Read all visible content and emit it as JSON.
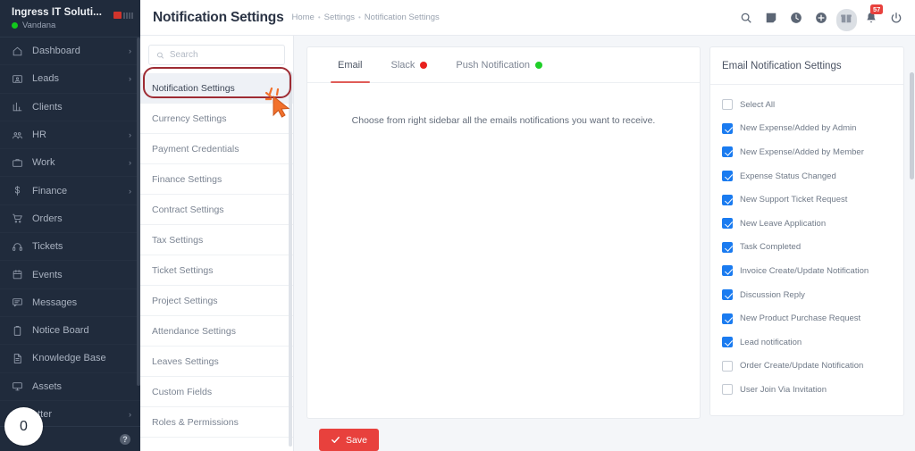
{
  "sidebar": {
    "company": "Ingress IT Soluti...",
    "user": "Vandana",
    "status_color": "#12c81c",
    "items": [
      {
        "label": "Dashboard",
        "icon": "home-icon",
        "chevron": "›"
      },
      {
        "label": "Leads",
        "icon": "leads-card-icon",
        "chevron": "›"
      },
      {
        "label": "Clients",
        "icon": "bar-chart-icon",
        "chevron": ""
      },
      {
        "label": "HR",
        "icon": "people-icon",
        "chevron": "›"
      },
      {
        "label": "Work",
        "icon": "briefcase-icon",
        "chevron": "›"
      },
      {
        "label": "Finance",
        "icon": "dollar-icon",
        "chevron": "›"
      },
      {
        "label": "Orders",
        "icon": "cart-icon",
        "chevron": ""
      },
      {
        "label": "Tickets",
        "icon": "headset-icon",
        "chevron": ""
      },
      {
        "label": "Events",
        "icon": "calendar-icon",
        "chevron": ""
      },
      {
        "label": "Messages",
        "icon": "chat-icon",
        "chevron": ""
      },
      {
        "label": "Notice Board",
        "icon": "clipboard-icon",
        "chevron": ""
      },
      {
        "label": "Knowledge Base",
        "icon": "document-icon",
        "chevron": ""
      },
      {
        "label": "Assets",
        "icon": "monitor-icon",
        "chevron": ""
      },
      {
        "label": "etter",
        "icon": "newsletter-icon",
        "chevron": "›"
      }
    ],
    "bubble_count": "0",
    "help_glyph": "?"
  },
  "header": {
    "title": "Notification Settings",
    "breadcrumbs": [
      "Home",
      "Settings",
      "Notification Settings"
    ],
    "separator": "•",
    "icons": [
      {
        "name": "search-icon"
      },
      {
        "name": "note-icon"
      },
      {
        "name": "clock-icon"
      },
      {
        "name": "plus-circle-icon"
      },
      {
        "name": "gift-icon"
      },
      {
        "name": "bell-icon",
        "badge": "57"
      },
      {
        "name": "power-icon"
      }
    ]
  },
  "settings_list": {
    "search_placeholder": "Search",
    "search_value": "",
    "items": [
      {
        "label": "Notification Settings",
        "active": true
      },
      {
        "label": "Currency Settings",
        "active": false
      },
      {
        "label": "Payment Credentials",
        "active": false
      },
      {
        "label": "Finance Settings",
        "active": false
      },
      {
        "label": "Contract Settings",
        "active": false
      },
      {
        "label": "Tax Settings",
        "active": false
      },
      {
        "label": "Ticket Settings",
        "active": false
      },
      {
        "label": "Project Settings",
        "active": false
      },
      {
        "label": "Attendance Settings",
        "active": false
      },
      {
        "label": "Leaves Settings",
        "active": false
      },
      {
        "label": "Custom Fields",
        "active": false
      },
      {
        "label": "Roles & Permissions",
        "active": false
      }
    ],
    "highlight_color": "#9e2b33"
  },
  "tabs": [
    {
      "label": "Email",
      "active": true,
      "dot": ""
    },
    {
      "label": "Slack",
      "active": false,
      "dot": "#e8201e"
    },
    {
      "label": "Push Notification",
      "active": false,
      "dot": "#1fcf28"
    }
  ],
  "panel": {
    "message": "Choose from right sidebar all the emails notifications you want to receive."
  },
  "email_settings": {
    "title": "Email Notification Settings",
    "options": [
      {
        "label": "Select All",
        "checked": false
      },
      {
        "label": "New Expense/Added by Admin",
        "checked": true
      },
      {
        "label": "New Expense/Added by Member",
        "checked": true
      },
      {
        "label": "Expense Status Changed",
        "checked": true
      },
      {
        "label": "New Support Ticket Request",
        "checked": true
      },
      {
        "label": "New Leave Application",
        "checked": true
      },
      {
        "label": "Task Completed",
        "checked": true
      },
      {
        "label": "Invoice Create/Update Notification",
        "checked": true
      },
      {
        "label": "Discussion Reply",
        "checked": true
      },
      {
        "label": "New Product Purchase Request",
        "checked": true
      },
      {
        "label": "Lead notification",
        "checked": true
      },
      {
        "label": "Order Create/Update Notification",
        "checked": false
      },
      {
        "label": "User Join Via Invitation",
        "checked": false
      }
    ],
    "checked_color": "#1a7bf0"
  },
  "footer": {
    "save_label": "Save",
    "save_color": "#e8413d"
  }
}
